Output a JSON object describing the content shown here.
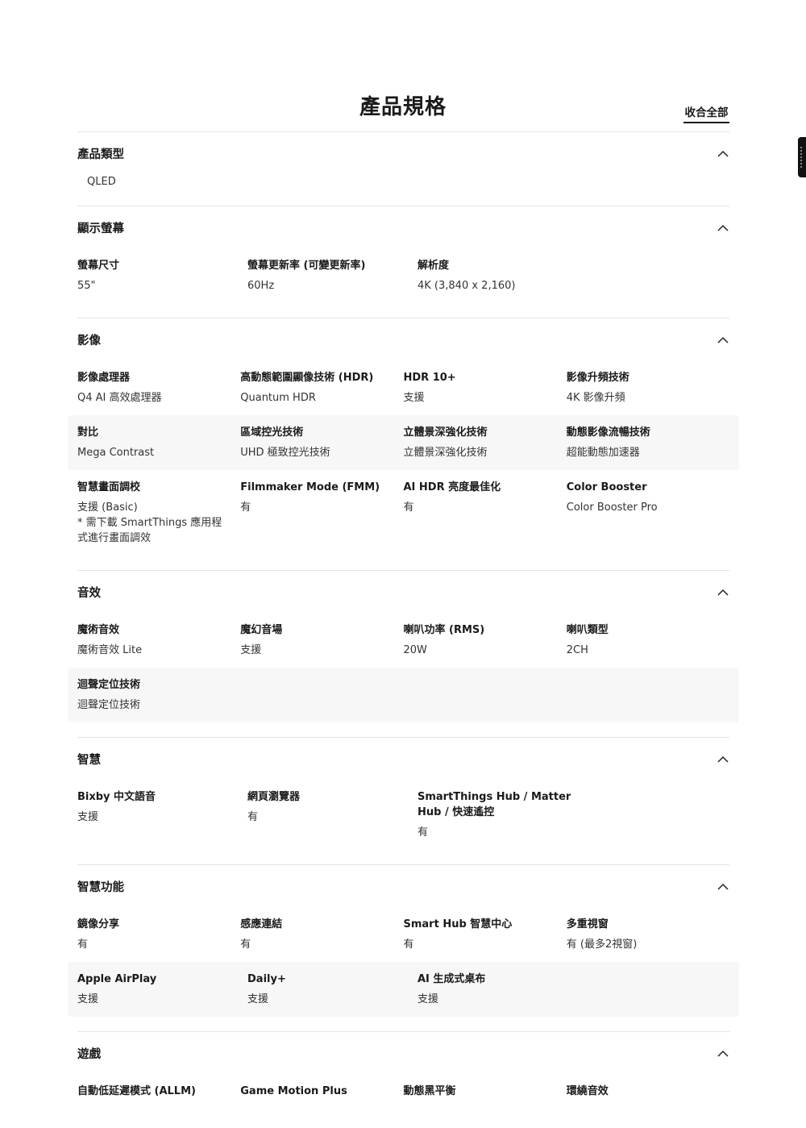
{
  "header": {
    "title": "產品規格",
    "collapse_all": "收合全部"
  },
  "sections": [
    {
      "title": "產品類型",
      "value": "QLED"
    },
    {
      "title": "顯示螢幕",
      "rows": [
        [
          {
            "label": "螢幕尺寸",
            "value": "55\""
          },
          {
            "label": "螢幕更新率 (可變更新率)",
            "value": "60Hz"
          },
          {
            "label": "解析度",
            "value": "4K (3,840 x 2,160)"
          }
        ]
      ]
    },
    {
      "title": "影像",
      "rows": [
        [
          {
            "label": "影像處理器",
            "value": "Q4 AI 高效處理器"
          },
          {
            "label": "高動態範圍顯像技術 (HDR)",
            "value": "Quantum HDR"
          },
          {
            "label": "HDR 10+",
            "value": "支援"
          },
          {
            "label": "影像升頻技術",
            "value": "4K 影像升頻"
          }
        ],
        [
          {
            "label": "對比",
            "value": "Mega Contrast"
          },
          {
            "label": "區域控光技術",
            "value": "UHD 極致控光技術"
          },
          {
            "label": "立體景深強化技術",
            "value": "立體景深強化技術"
          },
          {
            "label": "動態影像流暢技術",
            "value": "超能動態加速器"
          }
        ],
        [
          {
            "label": "智慧畫面調校",
            "value": "支援 (Basic)\n* 需下載 SmartThings 應用程式進行畫面調效"
          },
          {
            "label": "Filmmaker Mode (FMM)",
            "value": "有"
          },
          {
            "label": "AI HDR 亮度最佳化",
            "value": "有"
          },
          {
            "label": "Color Booster",
            "value": "Color Booster Pro"
          }
        ]
      ]
    },
    {
      "title": "音效",
      "rows": [
        [
          {
            "label": "魔術音效",
            "value": "魔術音效 Lite"
          },
          {
            "label": "魔幻音場",
            "value": "支援"
          },
          {
            "label": "喇叭功率 (RMS)",
            "value": "20W"
          },
          {
            "label": "喇叭類型",
            "value": "2CH"
          }
        ],
        [
          {
            "label": "迴聲定位技術",
            "value": "迴聲定位技術"
          }
        ]
      ]
    },
    {
      "title": "智慧",
      "rows": [
        [
          {
            "label": "Bixby 中文語音",
            "value": "支援"
          },
          {
            "label": "網頁瀏覽器",
            "value": "有"
          },
          {
            "label": "SmartThings Hub / Matter Hub / 快速遙控",
            "value": "有"
          }
        ]
      ]
    },
    {
      "title": "智慧功能",
      "rows": [
        [
          {
            "label": "鏡像分享",
            "value": "有"
          },
          {
            "label": "感應連結",
            "value": "有"
          },
          {
            "label": "Smart Hub 智慧中心",
            "value": "有"
          },
          {
            "label": "多重視窗",
            "value": "有 (最多2視窗)"
          }
        ],
        [
          {
            "label": "Apple AirPlay",
            "value": "支援"
          },
          {
            "label": "Daily+",
            "value": "支援"
          },
          {
            "label": "AI 生成式桌布",
            "value": "支援"
          }
        ]
      ]
    },
    {
      "title": "遊戲",
      "rows": [
        [
          {
            "label": "自動低延遲模式 (ALLM)",
            "value": ""
          },
          {
            "label": "Game Motion Plus",
            "value": ""
          },
          {
            "label": "動態黑平衡",
            "value": ""
          },
          {
            "label": "環繞音效",
            "value": ""
          }
        ]
      ]
    }
  ]
}
